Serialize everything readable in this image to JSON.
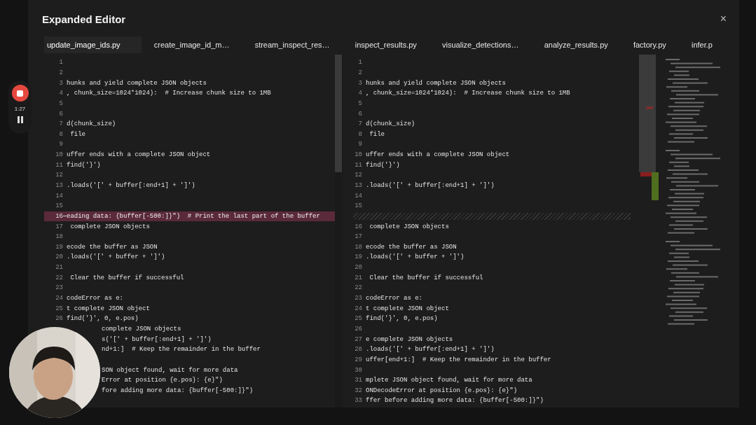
{
  "window": {
    "title": "Expanded Editor",
    "close": "×"
  },
  "recorder": {
    "time": "1:27"
  },
  "tabs": [
    {
      "label": "update_image_ids.py",
      "selected": true
    },
    {
      "label": "create_image_id_m…",
      "selected": false
    },
    {
      "label": "stream_inspect_res…",
      "selected": false
    },
    {
      "label": "inspect_results.py",
      "selected": false
    },
    {
      "label": "visualize_detections…",
      "selected": false
    },
    {
      "label": "analyze_results.py",
      "selected": false
    },
    {
      "label": "factory.py",
      "selected": false
    },
    {
      "label": "infer.p",
      "selected": false
    }
  ],
  "left_pane": {
    "lines": [
      {
        "kind": "normal",
        "num": "1"
      },
      {
        "kind": "normal",
        "num": "2"
      },
      {
        "kind": "normal",
        "num": "3",
        "text": "hunks and yield complete JSON objects"
      },
      {
        "kind": "normal",
        "num": "4",
        "text": ", chunk_size=1024*1024):  # Increase chunk size to 1MB"
      },
      {
        "kind": "normal",
        "num": "5"
      },
      {
        "kind": "normal",
        "num": "6"
      },
      {
        "kind": "normal",
        "num": "7",
        "text": "d(chunk_size)"
      },
      {
        "kind": "normal",
        "num": "8",
        "text": " file"
      },
      {
        "kind": "normal",
        "num": "9"
      },
      {
        "kind": "normal",
        "num": "10",
        "text": "uffer ends with a complete JSON object"
      },
      {
        "kind": "normal",
        "num": "11",
        "text": "find('}')"
      },
      {
        "kind": "normal",
        "num": "12"
      },
      {
        "kind": "normal",
        "num": "13",
        "text": ".loads('[' + buffer[:end+1] + ']')"
      },
      {
        "kind": "normal",
        "num": "14"
      },
      {
        "kind": "normal",
        "num": "15"
      },
      {
        "kind": "removed",
        "num": "16",
        "text": "eading data: {buffer[-500:]}\")  # Print the last part of the buffer"
      },
      {
        "kind": "normal",
        "num": "17",
        "text": " complete JSON objects"
      },
      {
        "kind": "normal",
        "num": "18"
      },
      {
        "kind": "normal",
        "num": "19",
        "text": "ecode the buffer as JSON"
      },
      {
        "kind": "normal",
        "num": "20",
        "text": ".loads('[' + buffer + ']')"
      },
      {
        "kind": "normal",
        "num": "21"
      },
      {
        "kind": "normal",
        "num": "22",
        "text": " Clear the buffer if successful"
      },
      {
        "kind": "normal",
        "num": "23"
      },
      {
        "kind": "normal",
        "num": "24",
        "text": "codeError as e:"
      },
      {
        "kind": "normal",
        "num": "25",
        "text": "t complete JSON object"
      },
      {
        "kind": "normal",
        "num": "26",
        "text": "find('}', 0, e.pos)"
      },
      {
        "kind": "covered",
        "text": "complete JSON objects"
      },
      {
        "kind": "covered",
        "text": "s('[' + buffer[:end+1] + ']')"
      },
      {
        "kind": "covered",
        "text": "nd+1:]  # Keep the remainder in the buffer"
      },
      {
        "kind": "covered"
      },
      {
        "kind": "covered",
        "text": "SON object found, wait for more data"
      },
      {
        "kind": "covered",
        "text": "Error at position {e.pos}: {e}\")"
      },
      {
        "kind": "covered",
        "text": "fore adding more data: {buffer[-500:]}\")"
      }
    ]
  },
  "right_pane": {
    "lines": [
      {
        "kind": "normal",
        "num": "1"
      },
      {
        "kind": "normal",
        "num": "2"
      },
      {
        "kind": "normal",
        "num": "3",
        "text": "hunks and yield complete JSON objects"
      },
      {
        "kind": "normal",
        "num": "4",
        "text": ", chunk_size=1024*1024):  # Increase chunk size to 1MB"
      },
      {
        "kind": "normal",
        "num": "5"
      },
      {
        "kind": "normal",
        "num": "6"
      },
      {
        "kind": "normal",
        "num": "7",
        "text": "d(chunk_size)"
      },
      {
        "kind": "normal",
        "num": "8",
        "text": " file"
      },
      {
        "kind": "normal",
        "num": "9"
      },
      {
        "kind": "normal",
        "num": "10",
        "text": "uffer ends with a complete JSON object"
      },
      {
        "kind": "normal",
        "num": "11",
        "text": "find('}')"
      },
      {
        "kind": "normal",
        "num": "12"
      },
      {
        "kind": "normal",
        "num": "13",
        "text": ".loads('[' + buffer[:end+1] + ']')"
      },
      {
        "kind": "normal",
        "num": "14"
      },
      {
        "kind": "normal",
        "num": "15"
      },
      {
        "kind": "gap"
      },
      {
        "kind": "normal",
        "num": "16",
        "text": " complete JSON objects"
      },
      {
        "kind": "normal",
        "num": "17"
      },
      {
        "kind": "normal",
        "num": "18",
        "text": "ecode the buffer as JSON"
      },
      {
        "kind": "normal",
        "num": "19",
        "text": ".loads('[' + buffer + ']')"
      },
      {
        "kind": "normal",
        "num": "20"
      },
      {
        "kind": "normal",
        "num": "21",
        "text": " Clear the buffer if successful"
      },
      {
        "kind": "normal",
        "num": "22"
      },
      {
        "kind": "normal",
        "num": "23",
        "text": "codeError as e:"
      },
      {
        "kind": "normal",
        "num": "24",
        "text": "t complete JSON object"
      },
      {
        "kind": "normal",
        "num": "25",
        "text": "find('}', 0, e.pos)"
      },
      {
        "kind": "normal",
        "num": "26"
      },
      {
        "kind": "normal",
        "num": "27",
        "text": "e complete JSON objects"
      },
      {
        "kind": "normal",
        "num": "28",
        "text": ".loads('[' + buffer[:end+1] + ']')"
      },
      {
        "kind": "normal",
        "num": "29",
        "text": "uffer[end+1:]  # Keep the remainder in the buffer"
      },
      {
        "kind": "normal",
        "num": "30"
      },
      {
        "kind": "normal",
        "num": "31",
        "text": "mplete JSON object found, wait for more data"
      },
      {
        "kind": "normal",
        "num": "32",
        "text": "ONDecodeError at position {e.pos}: {e}\")"
      },
      {
        "kind": "normal",
        "num": "33",
        "text": "ffer before adding more data: {buffer[-500:]}\")"
      }
    ]
  }
}
